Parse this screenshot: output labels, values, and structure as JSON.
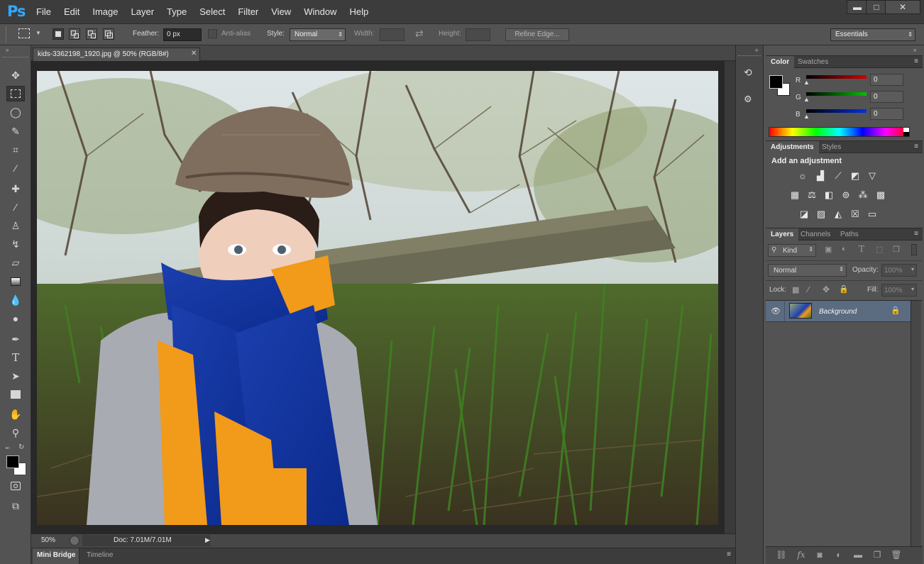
{
  "app": {
    "logo": "Ps"
  },
  "menu": [
    "File",
    "Edit",
    "Image",
    "Layer",
    "Type",
    "Select",
    "Filter",
    "View",
    "Window",
    "Help"
  ],
  "window_controls": {
    "minimize": "▬",
    "maximize": "□",
    "close": "✕"
  },
  "options_bar": {
    "feather_label": "Feather:",
    "feather_value": "0 px",
    "antialias_label": "Anti-alias",
    "style_label": "Style:",
    "style_value": "Normal",
    "width_label": "Width:",
    "height_label": "Height:",
    "refine_edge": "Refine Edge...",
    "workspace": "Essentials"
  },
  "document": {
    "tab_title": "kids-3362198_1920.jpg @ 50% (RGB/8#)",
    "zoom": "50%",
    "doc_size": "Doc: 7.01M/7.01M"
  },
  "bottom_tabs": [
    "Mini Bridge",
    "Timeline"
  ],
  "color_panel": {
    "tabs": [
      "Color",
      "Swatches"
    ],
    "channels": [
      {
        "label": "R",
        "value": "0",
        "color": "#d00000"
      },
      {
        "label": "G",
        "value": "0",
        "color": "#00c000"
      },
      {
        "label": "B",
        "value": "0",
        "color": "#0030e0"
      }
    ]
  },
  "adjustments_panel": {
    "tabs": [
      "Adjustments",
      "Styles"
    ],
    "heading": "Add an adjustment",
    "icons": [
      [
        "brightness-contrast-icon",
        "levels-icon",
        "curves-icon",
        "exposure-icon",
        "vibrance-icon"
      ],
      [
        "hue-saturation-icon",
        "color-balance-icon",
        "black-white-icon",
        "photo-filter-icon",
        "channel-mixer-icon",
        "color-lookup-icon"
      ],
      [
        "invert-icon",
        "posterize-icon",
        "threshold-icon",
        "selective-color-icon",
        "gradient-map-icon"
      ]
    ]
  },
  "layers_panel": {
    "tabs": [
      "Layers",
      "Channels",
      "Paths"
    ],
    "filter_kind": "Kind",
    "blend_mode": "Normal",
    "opacity_label": "Opacity:",
    "opacity_value": "100%",
    "lock_label": "Lock:",
    "fill_label": "Fill:",
    "fill_value": "100%",
    "layers": [
      {
        "name": "Background",
        "visible": true,
        "locked": true
      }
    ]
  }
}
